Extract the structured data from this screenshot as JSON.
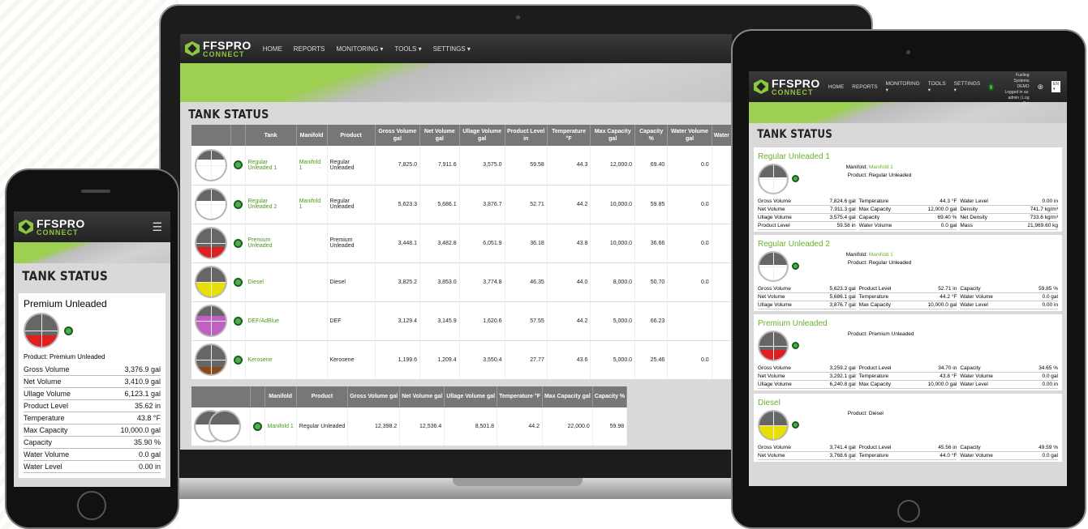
{
  "brand": {
    "line1": "FFSPRO",
    "line2": "CONNECT"
  },
  "nav": [
    "HOME",
    "REPORTS",
    "MONITORING ▾",
    "TOOLS ▾",
    "SETTINGS ▾"
  ],
  "title": "TANK STATUS",
  "headers": [
    "Tank",
    "Manifold",
    "Product",
    "Gross Volume gal",
    "Net Volume gal",
    "Ullage Volume gal",
    "Product Level in",
    "Temperature °F",
    "Max Capacity gal",
    "Capacity %",
    "Water Volume gal",
    "Water"
  ],
  "tanks": [
    {
      "name": "Regular Unleaded 1",
      "manifold": "Manifold 1",
      "product": "Regular Unleaded",
      "gross": "7,825.0",
      "net": "7,911.6",
      "ullage": "3,575.0",
      "level": "59.58",
      "temp": "44.3",
      "max": "12,000.0",
      "cap": "69.40",
      "water": "0.0",
      "color": "#ffffff"
    },
    {
      "name": "Regular Unleaded 2",
      "manifold": "Manifold 1",
      "product": "Regular Unleaded",
      "gross": "5,623.3",
      "net": "5,686.1",
      "ullage": "3,876.7",
      "level": "52.71",
      "temp": "44.2",
      "max": "10,000.0",
      "cap": "59.85",
      "water": "0.0",
      "color": "#ffffff"
    },
    {
      "name": "Premium Unleaded",
      "manifold": "",
      "product": "Premium Unleaded",
      "gross": "3,448.1",
      "net": "3,482.8",
      "ullage": "6,051.9",
      "level": "36.18",
      "temp": "43.8",
      "max": "10,000.0",
      "cap": "36.66",
      "water": "0.0",
      "color": "#e02020"
    },
    {
      "name": "Diesel",
      "manifold": "",
      "product": "Diesel",
      "gross": "3,825.2",
      "net": "3,853.0",
      "ullage": "3,774.8",
      "level": "46.35",
      "temp": "44.0",
      "max": "8,000.0",
      "cap": "50.70",
      "water": "0.0",
      "color": "#e8e000"
    },
    {
      "name": "DEF/AdBlue",
      "manifold": "",
      "product": "DEF",
      "gross": "3,129.4",
      "net": "3,145.9",
      "ullage": "1,620.6",
      "level": "57.55",
      "temp": "44.2",
      "max": "5,000.0",
      "cap": "66.23",
      "water": "",
      "color": "#c060c0"
    },
    {
      "name": "Kerosene",
      "manifold": "",
      "product": "Kerosene",
      "gross": "1,199.6",
      "net": "1,209.4",
      "ullage": "3,550.4",
      "level": "27.77",
      "temp": "43.6",
      "max": "5,000.0",
      "cap": "25.46",
      "water": "0.0",
      "color": "#8a4a1a"
    }
  ],
  "manifold_headers": [
    "Manifold",
    "Product",
    "Gross Volume gal",
    "Net Volume gal",
    "Ullage Volume gal",
    "Temperature °F",
    "Max Capacity gal",
    "Capacity %"
  ],
  "manifold_row": {
    "name": "Manifold 1",
    "product": "Regular Unleaded",
    "gross": "12,398.2",
    "net": "12,536.4",
    "ullage": "8,501.8",
    "temp": "44.2",
    "max": "22,000.0",
    "cap": "59.98"
  },
  "phone": {
    "tank": "Premium Unleaded",
    "product_label": "Product:",
    "product": "Premium Unleaded",
    "rows": [
      [
        "Gross Volume",
        "3,376.9 gal"
      ],
      [
        "Net Volume",
        "3,410.9 gal"
      ],
      [
        "Ullage Volume",
        "6,123.1 gal"
      ],
      [
        "Product Level",
        "35.62 in"
      ],
      [
        "Temperature",
        "43.8 °F"
      ],
      [
        "Max Capacity",
        "10,000.0 gal"
      ],
      [
        "Capacity",
        "35.90 %"
      ],
      [
        "Water Volume",
        "0.0 gal"
      ],
      [
        "Water Level",
        "0.00 in"
      ]
    ]
  },
  "tablet": {
    "user": "Franklin Fueling Systems DEMO",
    "logged": "Logged in as: admin | Log Out",
    "lang": "EN ▾",
    "cards": [
      {
        "name": "Regular Unleaded 1",
        "manifold": "Manifold 1",
        "product": "Regular Unleaded",
        "color": "#ffffff",
        "cells": [
          [
            "Gross Volume",
            "7,824.6 gal"
          ],
          [
            "Temperature",
            "44.3 °F"
          ],
          [
            "Water Level",
            "0.00 in"
          ],
          [
            "Net Volume",
            "7,911.3 gal"
          ],
          [
            "Max Capacity",
            "12,000.0 gal"
          ],
          [
            "Density",
            "741.7 kg/m³"
          ],
          [
            "Ullage Volume",
            "3,575.4 gal"
          ],
          [
            "Capacity",
            "69.40 %"
          ],
          [
            "Net Density",
            "733.6 kg/m³"
          ],
          [
            "Product Level",
            "59.58 in"
          ],
          [
            "Water Volume",
            "0.0 gal"
          ],
          [
            "Mass",
            "21,969.60 kg"
          ]
        ]
      },
      {
        "name": "Regular Unleaded 2",
        "manifold": "Manifold 1",
        "product": "Regular Unleaded",
        "color": "#ffffff",
        "cells": [
          [
            "Gross Volume",
            "5,623.3 gal"
          ],
          [
            "Product Level",
            "52.71 in"
          ],
          [
            "Capacity",
            "59.85 %"
          ],
          [
            "Net Volume",
            "5,686.1 gal"
          ],
          [
            "Temperature",
            "44.2 °F"
          ],
          [
            "Water Volume",
            "0.0 gal"
          ],
          [
            "Ullage Volume",
            "3,876.7 gal"
          ],
          [
            "Max Capacity",
            "10,000.0 gal"
          ],
          [
            "Water Level",
            "0.00 in"
          ]
        ]
      },
      {
        "name": "Premium Unleaded",
        "manifold": "",
        "product": "Premium Unleaded",
        "color": "#e02020",
        "cells": [
          [
            "Gross Volume",
            "3,259.2 gal"
          ],
          [
            "Product Level",
            "34.70 in"
          ],
          [
            "Capacity",
            "34.65 %"
          ],
          [
            "Net Volume",
            "3,292.1 gal"
          ],
          [
            "Temperature",
            "43.8 °F"
          ],
          [
            "Water Volume",
            "0.0 gal"
          ],
          [
            "Ullage Volume",
            "6,240.8 gal"
          ],
          [
            "Max Capacity",
            "10,000.0 gal"
          ],
          [
            "Water Level",
            "0.00 in"
          ]
        ]
      },
      {
        "name": "Diesel",
        "manifold": "",
        "product": "Diesel",
        "color": "#e8e000",
        "cells": [
          [
            "Gross Volume",
            "3,741.4 gal"
          ],
          [
            "Product Level",
            "45.56 in"
          ],
          [
            "Capacity",
            "49.59 %"
          ],
          [
            "Net Volume",
            "3,768.6 gal"
          ],
          [
            "Temperature",
            "44.0 °F"
          ],
          [
            "Water Volume",
            "0.0 gal"
          ]
        ]
      }
    ]
  }
}
